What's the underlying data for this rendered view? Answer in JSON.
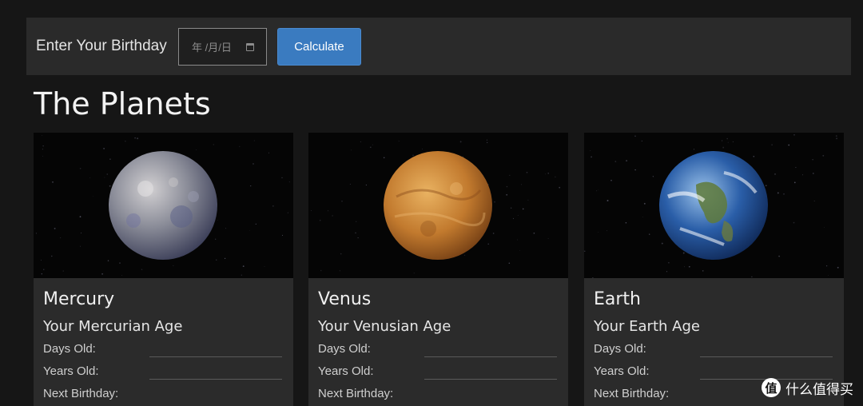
{
  "toolbar": {
    "label": "Enter Your Birthday",
    "date_placeholder": "年 /月/日",
    "date_icon": "calendar-icon",
    "calculate_label": "Calculate"
  },
  "page": {
    "title": "The Planets"
  },
  "planets": [
    {
      "name": "Mercury",
      "age_title": "Your Mercurian Age",
      "days_label": "Days Old:",
      "years_label": "Years Old:",
      "birthday_label": "Next Birthday:",
      "colors": {
        "base": "#8a8c98",
        "light": "#d2d0d2",
        "dark": "#3b3e58"
      }
    },
    {
      "name": "Venus",
      "age_title": "Your Venusian Age",
      "days_label": "Days Old:",
      "years_label": "Years Old:",
      "birthday_label": "Next Birthday:",
      "colors": {
        "base": "#c27a2e",
        "light": "#e9b261",
        "dark": "#6e3a12"
      }
    },
    {
      "name": "Earth",
      "age_title": "Your Earth Age",
      "days_label": "Days Old:",
      "years_label": "Years Old:",
      "birthday_label": "Next Birthday:",
      "colors": {
        "base": "#2a5ea8",
        "light": "#9cc3ea",
        "dark": "#0d2450"
      }
    }
  ],
  "watermark": {
    "icon_text": "值",
    "text": "什么值得买"
  }
}
